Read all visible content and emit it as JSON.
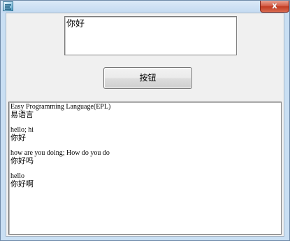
{
  "window": {
    "title": "",
    "icon": "app-window-icon",
    "close_icon": "close-icon",
    "close_label": "x"
  },
  "top_edit": {
    "value": "你好"
  },
  "button": {
    "label": "按钮"
  },
  "output": {
    "lines": [
      "Easy Programming Language(EPL)",
      "易语言",
      "",
      "hello; hi",
      "你好",
      "",
      "how are you doing; How do you do",
      "你好吗",
      "",
      "hello",
      "你好啊"
    ]
  },
  "colors": {
    "frame": "#c9dff3",
    "close_button": "#d45a43",
    "client_bg": "#f0f0f0"
  }
}
